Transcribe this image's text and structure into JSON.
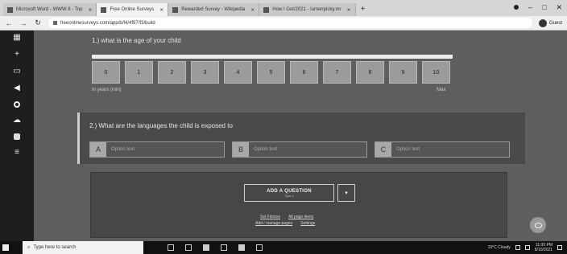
{
  "browser": {
    "tabs": [
      {
        "label": "Microsoft Word - WWW 8 - Top",
        "active": false
      },
      {
        "label": "Free Online Surveys",
        "active": true
      },
      {
        "label": "Rewarded Survey - Wikipedia",
        "active": false
      },
      {
        "label": "How I Got/2021 - lumenpicky.mr",
        "active": false
      }
    ],
    "new_tab_glyph": "+",
    "url": "freeonlinesurveys.com/app/b/f4/4f97/f3/build",
    "profile_label": "Guest"
  },
  "rail_icons": [
    "grid-icon",
    "plus-icon",
    "folder-icon",
    "megaphone-icon",
    "eye-icon",
    "cloud-icon",
    "briefcase-icon",
    "database-icon"
  ],
  "question1": {
    "title": "1.) what is the age of your child",
    "scale": [
      "0",
      "1",
      "2",
      "3",
      "4",
      "5",
      "6",
      "7",
      "8",
      "9",
      "10"
    ],
    "min_label": "In years (min)",
    "max_label": "Max"
  },
  "question2": {
    "title": "2.) What are the languages the child is exposed to",
    "options": [
      {
        "letter": "A",
        "placeholder": "Option text"
      },
      {
        "letter": "B",
        "placeholder": "Option text"
      },
      {
        "letter": "C",
        "placeholder": "Option text"
      }
    ]
  },
  "add_section": {
    "button_label": "ADD A QUESTION",
    "button_sub": "Type 1",
    "dropdown_glyph": "▾",
    "links_row1": [
      "Set Fitness",
      "All page items"
    ],
    "links_row2": [
      "Add / manage pages",
      "Settings"
    ]
  },
  "taskbar": {
    "search_placeholder": "Type here to search",
    "weather": "19°C Cloudy",
    "time": "11:00 PM",
    "date": "8/10/2021"
  },
  "colors": {
    "page_bg": "#5c5c5c",
    "rail_bg": "#1e1e1e",
    "card_bg": "#4a4a4a",
    "scale_cell": "#9b9b9b"
  }
}
